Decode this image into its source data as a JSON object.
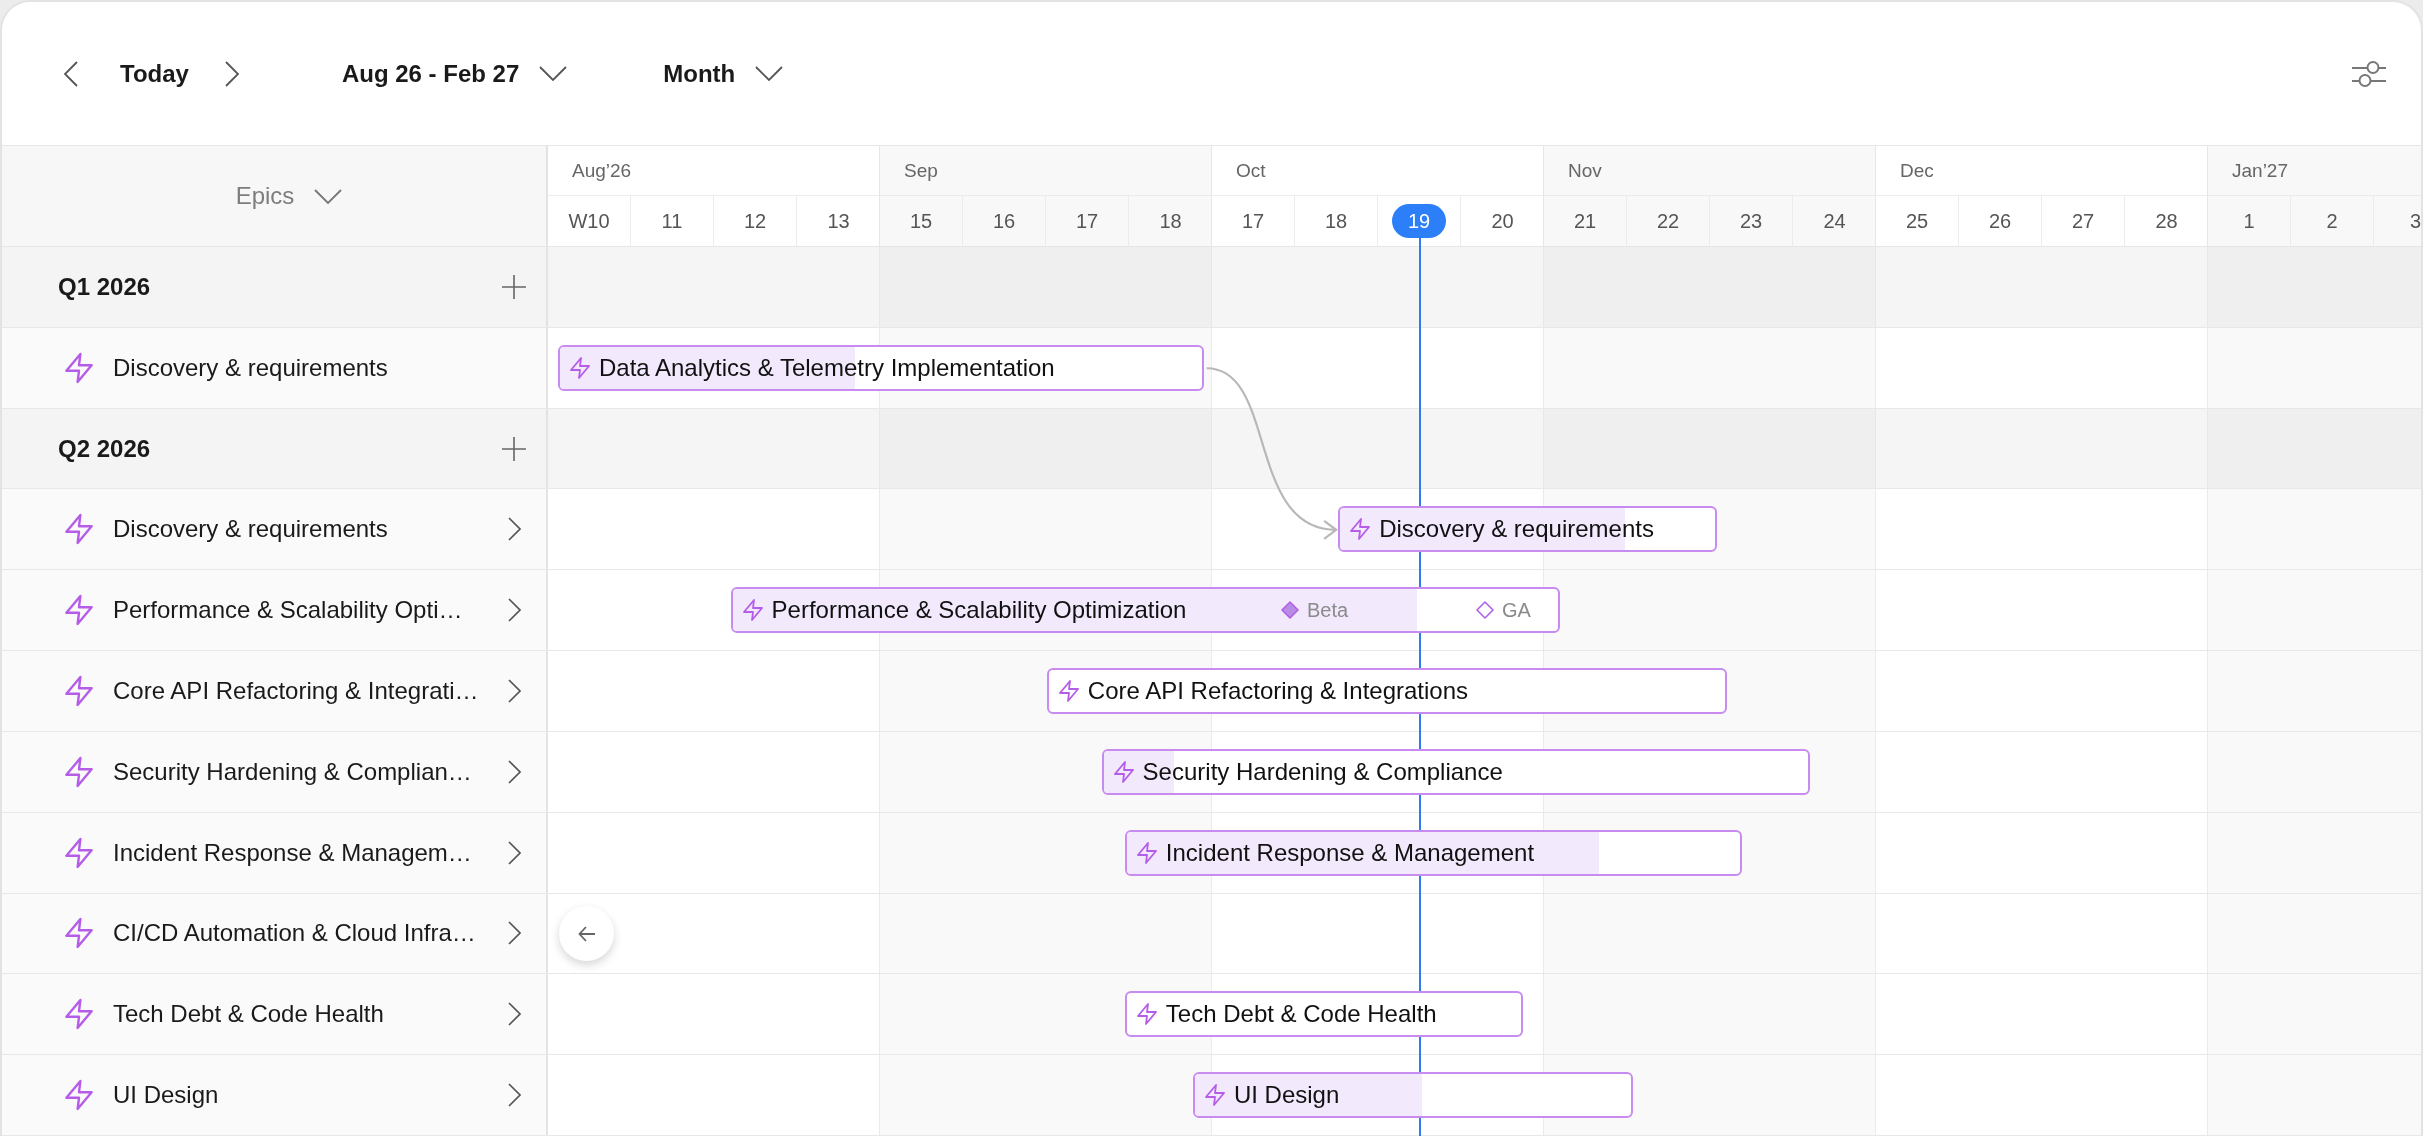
{
  "toolbar": {
    "today": "Today",
    "date_range": "Aug 26 - Feb 27",
    "scale": "Month"
  },
  "sidebar_header": {
    "label": "Epics"
  },
  "timeline": {
    "months": [
      {
        "label": "Aug’26",
        "weeks": [
          {
            "label": "W10",
            "today": false
          },
          {
            "label": "11",
            "today": false
          },
          {
            "label": "12",
            "today": false
          },
          {
            "label": "13",
            "today": false
          }
        ]
      },
      {
        "label": "Sep",
        "weeks": [
          {
            "label": "15",
            "today": false
          },
          {
            "label": "16",
            "today": false
          },
          {
            "label": "17",
            "today": false
          },
          {
            "label": "18",
            "today": false
          }
        ]
      },
      {
        "label": "Oct",
        "weeks": [
          {
            "label": "17",
            "today": false
          },
          {
            "label": "18",
            "today": false
          },
          {
            "label": "19",
            "today": true
          },
          {
            "label": "20",
            "today": false
          }
        ]
      },
      {
        "label": "Nov",
        "weeks": [
          {
            "label": "21",
            "today": false
          },
          {
            "label": "22",
            "today": false
          },
          {
            "label": "23",
            "today": false
          },
          {
            "label": "24",
            "today": false
          }
        ]
      },
      {
        "label": "Dec",
        "weeks": [
          {
            "label": "25",
            "today": false
          },
          {
            "label": "26",
            "today": false
          },
          {
            "label": "27",
            "today": false
          },
          {
            "label": "28",
            "today": false
          }
        ]
      },
      {
        "label": "Jan’27",
        "weeks": [
          {
            "label": "1",
            "today": false
          },
          {
            "label": "2",
            "today": false
          },
          {
            "label": "3",
            "today": false
          }
        ]
      }
    ]
  },
  "rows": [
    {
      "kind": "group",
      "label": "Q1 2026"
    },
    {
      "kind": "epic",
      "label": "Discovery & requirements",
      "expandable": false,
      "bar": {
        "kind": "shown",
        "label": "Data Analytics & Telemetry Implementation",
        "level": 0.46,
        "depends_on_previous": false
      }
    },
    {
      "kind": "group",
      "label": "Q2 2026"
    },
    {
      "kind": "epic",
      "label": "Discovery & requirements",
      "expandable": true,
      "bar": {
        "kind": "shown",
        "label": "Discovery & requirements",
        "level": 0.76,
        "depends_on_previous": true
      }
    },
    {
      "kind": "epic",
      "label": "Performance & Scalability Opti…",
      "expandable": true,
      "bar": {
        "kind": "shown",
        "label": "Performance & Scalability Optimization",
        "level": 0.83,
        "depends_on_previous": false,
        "milestones": [
          {
            "label": "Beta",
            "done": true
          },
          {
            "label": "GA",
            "done": false
          }
        ]
      }
    },
    {
      "kind": "epic",
      "label": "Core API Refactoring & Integrati…",
      "expandable": true,
      "bar": {
        "kind": "shown",
        "label": "Core API Refactoring & Integrations",
        "depends_on_previous": false
      }
    },
    {
      "kind": "epic",
      "label": "Security Hardening & Complian…",
      "expandable": true,
      "bar": {
        "kind": "shown",
        "label": "Security Hardening & Compliance",
        "level": 0.1,
        "depends_on_previous": false
      }
    },
    {
      "kind": "epic",
      "label": "Incident Response & Managem…",
      "expandable": true,
      "bar": {
        "kind": "shown",
        "label": "Incident Response & Management",
        "level": 0.77,
        "depends_on_previous": false
      }
    },
    {
      "kind": "epic",
      "label": "CI/CD Automation & Cloud Infra…",
      "expandable": true,
      "bar": {
        "kind": "offscreen"
      }
    },
    {
      "kind": "epic",
      "label": "Tech Debt & Code Health",
      "expandable": true,
      "bar": {
        "kind": "shown",
        "label": "Tech Debt & Code Health",
        "depends_on_previous": false
      }
    },
    {
      "kind": "epic",
      "label": "UI Design",
      "expandable": true,
      "bar": {
        "kind": "shown",
        "label": "UI Design",
        "level": 0.52,
        "depends_on_previous": false
      }
    }
  ]
}
